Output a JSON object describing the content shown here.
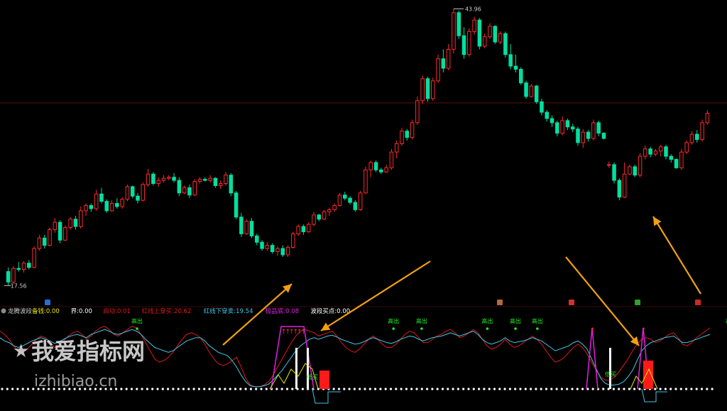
{
  "colors": {
    "background": "#000000",
    "up": "#ff2a2a",
    "down": "#00e0a0",
    "label_green": "#22ee22",
    "cyan": "#40c8e8",
    "red_line": "#e01818",
    "magenta": "#e020e0",
    "yellow": "#e8e800",
    "white": "#ffffff",
    "orange_arrow": "#f0a010",
    "grid": "#5a1010"
  },
  "watermark": {
    "cn": "我爱指标网",
    "url": "izhibiao.cn"
  },
  "indicator_header": {
    "name": "龙腾波段",
    "items": [
      {
        "label": "备钱:",
        "value": "0.00",
        "color": "#e8e800"
      },
      {
        "label": "界:",
        "value": "0.00",
        "color": "#ffffff"
      },
      {
        "label": "启动:",
        "value": "0.01",
        "color": "#e01818"
      },
      {
        "label": "红线上穿买:",
        "value": "20.62",
        "color": "#e01818"
      },
      {
        "label": "红线下穿卖:",
        "value": "19.54",
        "color": "#40c8e8"
      },
      {
        "label": "极品底:",
        "value": "0.08",
        "color": "#e020e0"
      },
      {
        "label": "波段买点:",
        "value": "0.00",
        "color": "#ffffff"
      }
    ]
  },
  "chart_data": [
    {
      "type": "candlestick",
      "max_label": "43.96",
      "min_label": "17.56",
      "ylim": [
        16.5,
        44.4
      ],
      "candles": [
        [
          18.9,
          19.3,
          17.56,
          17.9
        ],
        [
          17.9,
          19.4,
          17.7,
          19.2
        ],
        [
          19.2,
          19.8,
          18.9,
          19.1
        ],
        [
          19.1,
          19.9,
          18.8,
          19.7
        ],
        [
          19.7,
          20.0,
          19.1,
          19.3
        ],
        [
          19.3,
          21.3,
          19.2,
          21.1
        ],
        [
          21.1,
          22.4,
          20.9,
          22.1
        ],
        [
          22.1,
          22.4,
          21.1,
          21.4
        ],
        [
          21.4,
          23.1,
          21.3,
          22.9
        ],
        [
          22.9,
          24.0,
          22.6,
          23.6
        ],
        [
          23.6,
          23.8,
          21.6,
          21.9
        ],
        [
          21.9,
          23.3,
          21.8,
          23.1
        ],
        [
          23.1,
          24.1,
          22.9,
          23.9
        ],
        [
          23.9,
          24.2,
          22.9,
          23.2
        ],
        [
          23.2,
          25.1,
          23.0,
          24.7
        ],
        [
          24.7,
          25.4,
          24.2,
          25.2
        ],
        [
          25.2,
          25.4,
          24.6,
          24.9
        ],
        [
          24.9,
          26.7,
          24.7,
          26.3
        ],
        [
          26.3,
          26.9,
          25.4,
          25.6
        ],
        [
          25.6,
          25.8,
          24.5,
          24.7
        ],
        [
          24.7,
          25.7,
          24.6,
          25.4
        ],
        [
          25.4,
          25.9,
          24.9,
          25.1
        ],
        [
          25.1,
          26.0,
          24.9,
          25.8
        ],
        [
          25.8,
          27.2,
          25.6,
          27.0
        ],
        [
          27.0,
          27.1,
          25.9,
          26.1
        ],
        [
          26.1,
          26.4,
          25.4,
          25.7
        ],
        [
          25.7,
          27.4,
          25.6,
          27.2
        ],
        [
          27.2,
          28.7,
          27.0,
          28.2
        ],
        [
          28.2,
          28.4,
          27.1,
          27.3
        ],
        [
          27.3,
          27.9,
          27.0,
          27.6
        ],
        [
          27.6,
          28.1,
          27.4,
          27.8
        ],
        [
          27.8,
          28.1,
          27.6,
          27.9
        ],
        [
          27.9,
          28.3,
          27.4,
          27.6
        ],
        [
          27.6,
          27.9,
          26.1,
          26.4
        ],
        [
          26.4,
          27.1,
          26.3,
          26.9
        ],
        [
          26.9,
          27.2,
          25.9,
          26.2
        ],
        [
          26.2,
          27.7,
          26.1,
          27.5
        ],
        [
          27.5,
          27.9,
          27.3,
          27.7
        ],
        [
          27.7,
          27.9,
          27.5,
          27.6
        ],
        [
          27.6,
          28.1,
          27.4,
          27.8
        ],
        [
          27.8,
          27.9,
          26.9,
          27.1
        ],
        [
          27.1,
          27.6,
          26.8,
          27.3
        ],
        [
          27.3,
          28.4,
          27.1,
          28.1
        ],
        [
          28.1,
          28.3,
          26.1,
          26.4
        ],
        [
          26.4,
          26.6,
          23.9,
          24.1
        ],
        [
          24.1,
          24.5,
          22.2,
          22.5
        ],
        [
          22.5,
          23.9,
          22.4,
          23.7
        ],
        [
          23.7,
          24.0,
          22.1,
          22.3
        ],
        [
          22.3,
          22.5,
          21.4,
          21.7
        ],
        [
          21.7,
          21.9,
          20.9,
          21.1
        ],
        [
          21.1,
          21.7,
          20.9,
          21.4
        ],
        [
          21.4,
          21.6,
          20.6,
          20.8
        ],
        [
          20.8,
          21.3,
          20.4,
          21.1
        ],
        [
          21.1,
          21.4,
          20.3,
          20.5
        ],
        [
          20.5,
          21.4,
          20.3,
          21.2
        ],
        [
          21.2,
          22.7,
          21.1,
          22.5
        ],
        [
          22.5,
          23.4,
          22.3,
          23.2
        ],
        [
          23.2,
          23.4,
          22.4,
          22.7
        ],
        [
          22.7,
          23.6,
          22.6,
          23.4
        ],
        [
          23.4,
          24.6,
          23.2,
          24.3
        ],
        [
          24.3,
          24.4,
          23.7,
          23.9
        ],
        [
          23.9,
          24.8,
          23.8,
          24.6
        ],
        [
          24.6,
          25.0,
          24.2,
          24.8
        ],
        [
          24.8,
          25.4,
          24.6,
          25.2
        ],
        [
          25.2,
          26.4,
          25.1,
          26.2
        ],
        [
          26.2,
          26.5,
          25.7,
          25.9
        ],
        [
          25.9,
          26.1,
          25.3,
          25.5
        ],
        [
          25.5,
          25.7,
          24.6,
          24.8
        ],
        [
          24.8,
          26.6,
          24.7,
          26.4
        ],
        [
          26.4,
          28.9,
          26.3,
          28.6
        ],
        [
          28.6,
          29.5,
          27.9,
          29.3
        ],
        [
          29.3,
          29.5,
          28.4,
          28.6
        ],
        [
          28.6,
          28.8,
          28.2,
          28.4
        ],
        [
          28.4,
          29.1,
          28.3,
          28.8
        ],
        [
          28.8,
          30.6,
          28.6,
          30.3
        ],
        [
          30.3,
          31.4,
          29.7,
          31.1
        ],
        [
          31.1,
          32.6,
          30.9,
          32.3
        ],
        [
          32.3,
          32.5,
          31.4,
          31.7
        ],
        [
          31.7,
          33.4,
          31.5,
          33.1
        ],
        [
          33.1,
          35.6,
          32.9,
          35.2
        ],
        [
          35.2,
          37.6,
          34.9,
          37.3
        ],
        [
          37.3,
          37.5,
          35.1,
          35.4
        ],
        [
          35.4,
          37.4,
          35.2,
          37.1
        ],
        [
          37.1,
          39.6,
          36.9,
          39.2
        ],
        [
          39.2,
          40.1,
          37.9,
          38.3
        ],
        [
          38.3,
          40.6,
          38.1,
          40.1
        ],
        [
          40.1,
          43.96,
          39.7,
          43.6
        ],
        [
          43.6,
          43.8,
          41.1,
          41.4
        ],
        [
          41.4,
          42.2,
          39.2,
          39.6
        ],
        [
          39.6,
          42.1,
          39.4,
          41.8
        ],
        [
          41.8,
          43.2,
          41.5,
          42.9
        ],
        [
          42.9,
          43.1,
          40.1,
          40.4
        ],
        [
          40.4,
          41.6,
          40.2,
          41.3
        ],
        [
          41.3,
          42.6,
          41.1,
          42.3
        ],
        [
          42.3,
          42.4,
          40.6,
          40.8
        ],
        [
          40.8,
          41.8,
          40.6,
          41.6
        ],
        [
          41.6,
          41.8,
          39.3,
          39.6
        ],
        [
          39.6,
          40.6,
          38.2,
          38.5
        ],
        [
          38.5,
          39.6,
          37.9,
          38.2
        ],
        [
          38.2,
          38.4,
          36.7,
          36.9
        ],
        [
          36.9,
          37.1,
          35.4,
          35.6
        ],
        [
          35.6,
          36.8,
          35.5,
          36.6
        ],
        [
          36.6,
          36.7,
          34.9,
          35.1
        ],
        [
          35.1,
          35.4,
          33.8,
          34.1
        ],
        [
          34.1,
          34.3,
          33.2,
          33.5
        ],
        [
          33.5,
          33.8,
          32.7,
          33.1
        ],
        [
          33.1,
          33.3,
          31.8,
          32.1
        ],
        [
          32.1,
          33.7,
          31.9,
          33.3
        ],
        [
          33.3,
          33.5,
          32.4,
          32.7
        ],
        [
          32.7,
          33.0,
          32.2,
          32.5
        ],
        [
          32.5,
          32.7,
          30.9,
          31.2
        ],
        [
          31.2,
          32.5,
          30.7,
          32.2
        ],
        [
          32.2,
          32.4,
          31.3,
          31.6
        ],
        [
          31.6,
          33.4,
          31.4,
          33.1
        ],
        [
          33.1,
          33.3,
          31.8,
          32.1
        ],
        [
          32.1,
          32.2,
          31.5,
          31.6
        ],
        [
          29.1,
          29.4,
          28.8,
          29.1
        ],
        [
          29.1,
          29.3,
          27.3,
          27.6
        ],
        [
          27.6,
          27.8,
          25.7,
          26.0
        ],
        [
          26.0,
          29.3,
          25.9,
          28.2
        ],
        [
          28.2,
          29.1,
          28.1,
          28.9
        ],
        [
          28.9,
          29.1,
          27.9,
          28.1
        ],
        [
          28.1,
          30.2,
          27.9,
          29.9
        ],
        [
          29.9,
          30.9,
          29.6,
          30.6
        ],
        [
          30.6,
          30.8,
          29.8,
          30.1
        ],
        [
          30.1,
          30.6,
          29.9,
          30.4
        ],
        [
          30.4,
          31.0,
          29.9,
          30.8
        ],
        [
          30.8,
          31.0,
          29.6,
          29.9
        ],
        [
          29.9,
          30.1,
          29.3,
          29.6
        ],
        [
          29.6,
          29.7,
          28.7,
          28.8
        ],
        [
          28.8,
          30.6,
          28.6,
          30.3
        ],
        [
          30.3,
          31.4,
          30.1,
          31.2
        ],
        [
          31.2,
          32.3,
          31.0,
          32.0
        ],
        [
          32.0,
          32.4,
          31.2,
          31.5
        ],
        [
          31.5,
          33.4,
          31.3,
          33.1
        ],
        [
          33.1,
          34.3,
          32.9,
          34.0
        ]
      ]
    },
    {
      "type": "indicator",
      "series": [],
      "annotations": [
        {
          "text": "高出",
          "x_index": 37
        },
        {
          "text": "高出",
          "x_index": 119
        },
        {
          "text": "高出",
          "x_index": 128
        },
        {
          "text": "高出",
          "x_index": 149
        },
        {
          "text": "高出",
          "x_index": 158
        },
        {
          "text": "高出",
          "x_index": 165
        },
        {
          "text": "高出",
          "x_index": 227
        }
      ],
      "cyan_line": [
        62,
        58,
        56,
        52,
        50,
        52,
        55,
        58,
        60,
        62,
        60,
        58,
        55,
        57,
        60,
        63,
        65,
        66,
        64,
        62,
        66,
        68,
        70,
        72,
        70,
        67,
        66,
        68,
        70,
        72,
        70,
        66,
        60,
        55,
        50,
        48,
        46,
        44,
        46,
        50,
        54,
        58,
        60,
        62,
        62,
        58,
        52,
        48,
        44,
        42,
        40,
        34,
        26,
        16,
        8,
        3,
        2,
        2,
        3,
        5,
        10,
        16,
        22,
        30,
        38,
        46,
        52,
        56,
        60,
        62,
        60,
        62,
        64,
        65,
        63,
        60,
        58,
        56,
        54,
        55,
        57,
        60,
        62,
        60,
        58,
        56,
        55,
        57,
        60,
        62,
        64,
        63,
        60,
        58,
        60,
        62,
        63,
        64,
        66,
        68,
        66,
        64,
        66,
        68,
        70,
        66,
        60,
        56,
        54,
        56,
        58,
        62,
        58,
        56,
        57,
        58,
        60,
        62,
        60,
        58,
        54,
        50,
        46,
        48,
        50,
        52,
        56,
        58,
        54,
        48,
        36,
        24,
        12,
        6,
        4,
        4,
        5,
        8,
        14,
        22,
        34,
        46,
        52,
        56,
        58,
        60,
        62,
        63,
        64,
        60,
        56,
        56,
        58,
        60,
        62,
        64,
        66
      ],
      "red_line": [
        70,
        66,
        60,
        52,
        45,
        44,
        48,
        54,
        60,
        64,
        62,
        56,
        50,
        52,
        58,
        64,
        68,
        70,
        66,
        60,
        64,
        70,
        74,
        76,
        72,
        66,
        64,
        68,
        72,
        76,
        74,
        66,
        56,
        46,
        36,
        32,
        34,
        38,
        44,
        52,
        60,
        66,
        68,
        66,
        62,
        54,
        44,
        36,
        30,
        28,
        30,
        34,
        38,
        26,
        12,
        4,
        2,
        2,
        4,
        8,
        16,
        26,
        36,
        46,
        56,
        64,
        70,
        72,
        70,
        68,
        64,
        66,
        68,
        70,
        64,
        56,
        50,
        46,
        44,
        48,
        54,
        60,
        64,
        60,
        54,
        50,
        50,
        54,
        60,
        66,
        70,
        68,
        62,
        56,
        56,
        60,
        64,
        66,
        70,
        72,
        68,
        62,
        64,
        68,
        72,
        68,
        60,
        52,
        48,
        50,
        54,
        60,
        54,
        50,
        52,
        56,
        60,
        64,
        60,
        54,
        46,
        38,
        32,
        34,
        38,
        44,
        50,
        54,
        50,
        42,
        32,
        22,
        14,
        10,
        10,
        14,
        20,
        28,
        36,
        46,
        54,
        60,
        62,
        60,
        56,
        58,
        62,
        66,
        68,
        62,
        54,
        52,
        56,
        62,
        66,
        70,
        74
      ]
    }
  ]
}
